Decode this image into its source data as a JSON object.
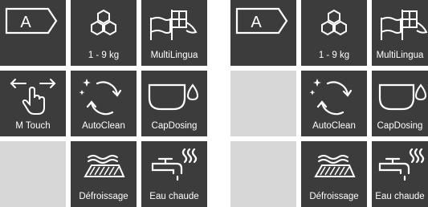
{
  "colors": {
    "tile_dark": "#3c3c3c",
    "tile_empty": "#d7d7d7",
    "icon": "#ffffff"
  },
  "left_panel": {
    "energy_class": {
      "letter": "A",
      "icon": "energy-class-arrow-icon"
    },
    "capacity": {
      "label": "1 - 9 kg",
      "icon": "hexagon-cluster-icon"
    },
    "multilingua": {
      "label": "MultiLingua",
      "icon": "flags-icon"
    },
    "mtouch": {
      "label": "M Touch",
      "icon": "swipe-hand-icon"
    },
    "autoclean": {
      "label": "AutoClean",
      "icon": "refresh-sparkle-icon"
    },
    "capdosing": {
      "label": "CapDosing",
      "icon": "capsule-drop-icon"
    },
    "defroissage": {
      "label": "Défroissage",
      "icon": "iron-wrinkle-icon"
    },
    "eau_chaude": {
      "label": "Eau chaude",
      "icon": "hot-water-tap-icon"
    }
  },
  "right_panel": {
    "energy_class": {
      "letter": "A",
      "icon": "energy-class-arrow-icon"
    },
    "capacity": {
      "label": "1 - 9 kg",
      "icon": "hexagon-cluster-icon"
    },
    "multilingua": {
      "label": "MultiLingua",
      "icon": "flags-icon"
    },
    "autoclean": {
      "label": "AutoClean",
      "icon": "refresh-sparkle-icon"
    },
    "capdosing": {
      "label": "CapDosing",
      "icon": "capsule-drop-icon"
    },
    "defroissage": {
      "label": "Défroissage",
      "icon": "iron-wrinkle-icon"
    },
    "eau_chaude": {
      "label": "Eau chaude",
      "icon": "hot-water-tap-icon"
    }
  }
}
